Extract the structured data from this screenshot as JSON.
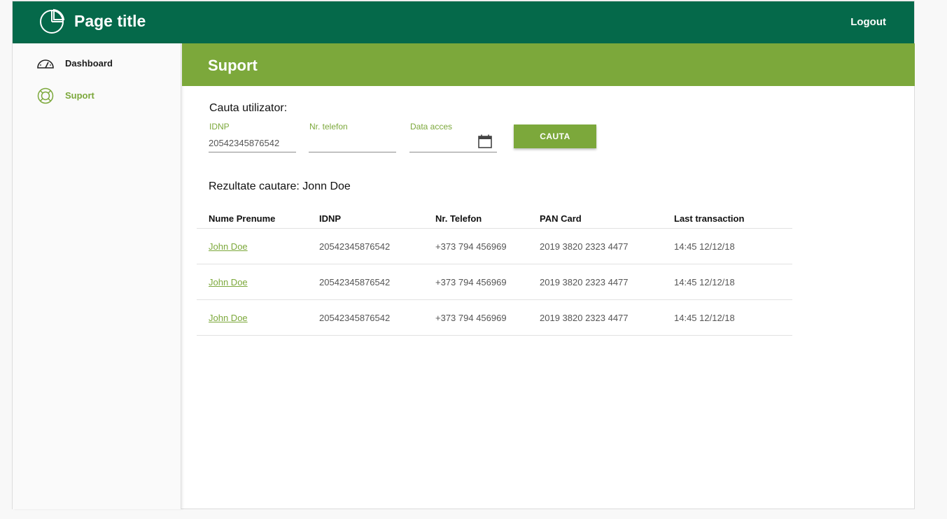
{
  "header": {
    "title": "Page title",
    "logout_label": "Logout"
  },
  "sidebar": {
    "items": [
      {
        "label": "Dashboard",
        "icon": "speedometer-icon",
        "active": false
      },
      {
        "label": "Suport",
        "icon": "lifebuoy-icon",
        "active": true
      }
    ]
  },
  "section": {
    "title": "Suport"
  },
  "search": {
    "heading": "Cauta utilizator:",
    "idnp": {
      "label": "IDNP",
      "value": "20542345876542"
    },
    "phone": {
      "label": "Nr. telefon",
      "value": ""
    },
    "date": {
      "label": "Data acces",
      "value": ""
    },
    "button_label": "CAUTA"
  },
  "results": {
    "heading": "Rezultate cautare: Jonn Doe",
    "columns": [
      "Nume Prenume",
      "IDNP",
      "Nr. Telefon",
      "PAN Card",
      "Last transaction"
    ],
    "rows": [
      [
        "John Doe",
        "20542345876542",
        "+373 794 456969",
        "2019 3820 2323 4477",
        "14:45 12/12/18"
      ],
      [
        "John Doe",
        "20542345876542",
        "+373 794 456969",
        "2019 3820 2323 4477",
        "14:45 12/12/18"
      ],
      [
        "John Doe",
        "20542345876542",
        "+373 794 456969",
        "2019 3820 2323 4477",
        "14:45 12/12/18"
      ]
    ]
  },
  "colors": {
    "primary_dark": "#05694a",
    "accent_green": "#7ca83b"
  }
}
